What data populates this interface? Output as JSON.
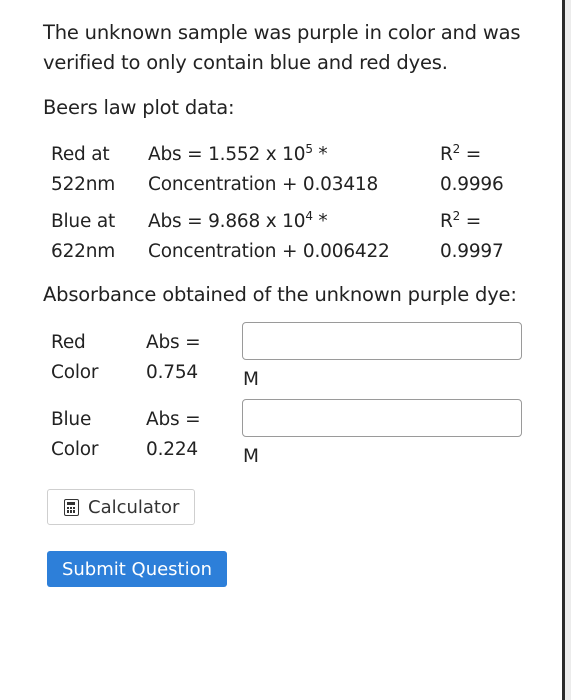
{
  "intro_text": "The unknown sample was purple in color and was verified to only contain blue and red dyes.",
  "beers_heading": "Beers law plot data:",
  "plots": [
    {
      "label_line1": "Red at",
      "label_line2": "522nm",
      "eq_line1_prefix": "Abs = 1.552 x 10",
      "eq_exponent": "5",
      "eq_line1_suffix": " *",
      "eq_line2": "Concentration + 0.03418",
      "r2_label": "R",
      "r2_exponent": "2",
      "r2_eq": " =",
      "r2_value": "0.9996"
    },
    {
      "label_line1": "Blue at",
      "label_line2": "622nm",
      "eq_line1_prefix": "Abs = 9.868 x 10",
      "eq_exponent": "4",
      "eq_line1_suffix": " *",
      "eq_line2": "Concentration + 0.006422",
      "r2_label": "R",
      "r2_exponent": "2",
      "r2_eq": " =",
      "r2_value": "0.9997"
    }
  ],
  "abs_heading": "Absorbance obtained of the unknown purple dye:",
  "samples": [
    {
      "label_line1": "Red",
      "label_line2": "Color",
      "abs_line1": "Abs =",
      "abs_line2": "0.754",
      "input_value": "",
      "unit": "M"
    },
    {
      "label_line1": "Blue",
      "label_line2": "Color",
      "abs_line1": "Abs =",
      "abs_line2": "0.224",
      "input_value": "",
      "unit": "M"
    }
  ],
  "calculator_label": "Calculator",
  "calculator_icon": "calculator-icon",
  "submit_label": "Submit Question",
  "accent_color": "#2d7fd9"
}
